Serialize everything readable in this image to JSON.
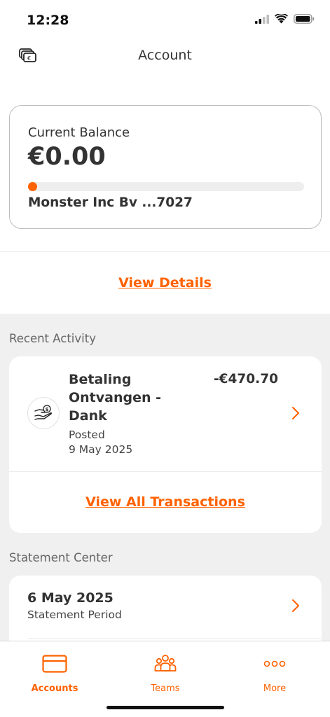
{
  "status_bar": {
    "time": "12:28",
    "icons": [
      "cellular-signal-icon",
      "wifi-icon",
      "battery-icon"
    ]
  },
  "header": {
    "title": "Account",
    "left_icon": "switch-accounts-icon"
  },
  "balance_card": {
    "label": "Current Balance",
    "amount": "€0.00",
    "progress_fraction": 0.0,
    "account_name": "Monster Inc Bv ...7027"
  },
  "view_details_label": "View Details",
  "recent_activity": {
    "heading": "Recent Activity",
    "transactions": [
      {
        "icon": "hand-money-icon",
        "title": "Betaling Ontvangen - Dank",
        "amount": "-€470.70",
        "status": "Posted",
        "date": "9 May 2025"
      }
    ],
    "view_all_label": "View All Transactions"
  },
  "statement_center": {
    "heading": "Statement Center",
    "statements": [
      {
        "date": "6 May 2025",
        "label": "Statement Period"
      }
    ]
  },
  "tab_bar": {
    "tabs": [
      {
        "label": "Accounts",
        "icon": "card-icon",
        "active": true
      },
      {
        "label": "Teams",
        "icon": "people-icon",
        "active": false
      },
      {
        "label": "More",
        "icon": "more-dots-icon",
        "active": false
      }
    ]
  },
  "colors": {
    "accent": "#ff6200",
    "background_grey": "#f0f0f0",
    "text_primary": "#333333"
  }
}
